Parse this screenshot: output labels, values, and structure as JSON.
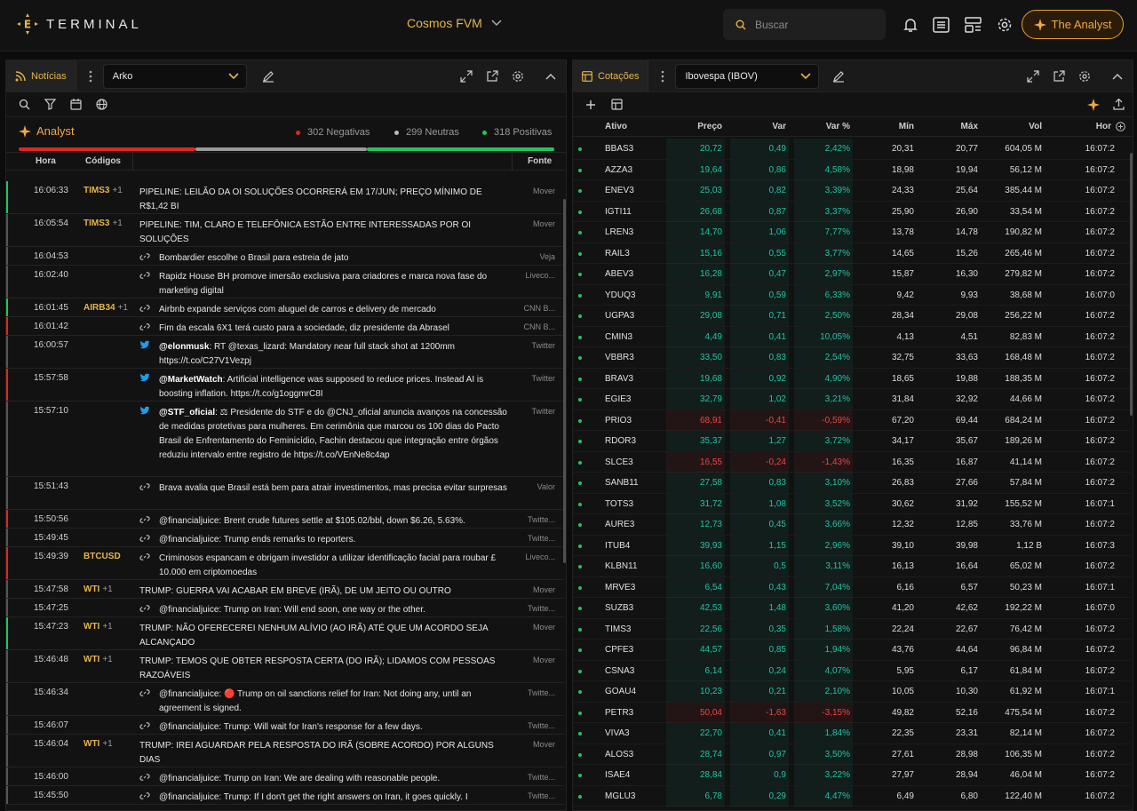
{
  "top": {
    "logo_text": "TERMINAL",
    "workspace": "Cosmos FVM",
    "search_placeholder": "Buscar",
    "analyst_btn": "The Analyst"
  },
  "news_panel": {
    "tab": "Notícias",
    "select": "Arko",
    "analyst": {
      "title": "Analyst",
      "negative": "302 Negativas",
      "neutral": "299 Neutras",
      "positive": "318 Positivas",
      "neg_frac": 0.33,
      "neu_frac": 0.32,
      "pos_frac": 0.35
    },
    "columns": {
      "hora": "Hora",
      "codigos": "Códigos",
      "fonte": "Fonte"
    },
    "rows": [
      {
        "time": "16:06:33",
        "code": "TIMS3",
        "extra": "+1",
        "link": false,
        "title": "PIPELINE: LEILÃO DA OI SOLUÇÕES OCORRERÁ EM 17/JUN; PREÇO MÍNIMO DE R$1,42 BI",
        "lines": 2,
        "src": "Mover",
        "bar": "#22c55e"
      },
      {
        "time": "16:05:54",
        "code": "TIMS3",
        "extra": "+1",
        "link": false,
        "title": "PIPELINE: TIM, CLARO E TELEFÔNICA ESTÃO ENTRE INTERESSADAS POR OI SOLUÇÕES",
        "lines": 2,
        "src": "Mover",
        "bar": "#555"
      },
      {
        "time": "16:04:53",
        "code": "",
        "extra": "",
        "link": "link",
        "title": "Bombardier escolhe o Brasil para estreia de jato",
        "lines": 1,
        "src": "Veja",
        "bar": "#555"
      },
      {
        "time": "16:02:40",
        "code": "",
        "extra": "",
        "link": "link",
        "title": "Rapidz House BH promove imersão exclusiva para criadores e marca nova fase do marketing digital",
        "lines": 2,
        "src": "Liveco...",
        "bar": "#555"
      },
      {
        "time": "16:01:45",
        "code": "AIRB34",
        "extra": "+1",
        "link": "link",
        "title": "Airbnb expande serviços com aluguel de carros e delivery de mercado",
        "lines": 1,
        "src": "CNN B...",
        "bar": "#22c55e"
      },
      {
        "time": "16:01:42",
        "code": "",
        "extra": "",
        "link": "link",
        "title": "Fim da escala 6X1 terá custo para a sociedade, diz presidente da Abrasel",
        "lines": 1,
        "src": "CNN B...",
        "bar": "#dc2626"
      },
      {
        "time": "16:00:57",
        "code": "",
        "extra": "",
        "link": "twitter",
        "handle": "@elonmusk",
        "title": ": RT @texas_lizard: Mandatory near full stack shot at 1200mm https://t.co/C27V1Vezpj",
        "lines": 2,
        "src": "Twitter",
        "bar": "#555"
      },
      {
        "time": "15:57:58",
        "code": "",
        "extra": "",
        "link": "twitter",
        "handle": "@MarketWatch",
        "title": ": Artificial intelligence was supposed to reduce prices. Instead AI is boosting inflation. https://t.co/g1oggmrC8I",
        "lines": 2,
        "src": "Twitter",
        "bar": "#dc2626"
      },
      {
        "time": "15:57:10",
        "code": "",
        "extra": "",
        "link": "twitter",
        "handle": "@STF_oficial",
        "title": ": ⚖ Presidente do STF e do @CNJ_oficial anuncia avanços na concessão de medidas protetivas para mulheres. Em cerimônia que marcou os 100 dias do Pacto Brasil de Enfrentamento do Feminicídio, Fachin destacou que integração entre órgãos reduziu intervalo entre registro de https://t.co/VEnNe8c4ap",
        "lines": 5,
        "src": "Twitter",
        "bar": "#555"
      },
      {
        "time": "15:51:43",
        "code": "",
        "extra": "",
        "link": "link",
        "title": "Brava avalia que Brasil está bem para atrair investimentos, mas precisa evitar surpresas",
        "lines": 2,
        "src": "Valor",
        "bar": "#555"
      },
      {
        "time": "15:50:56",
        "code": "",
        "extra": "",
        "link": "link",
        "title": "@financialjuice: Brent crude futures settle at $105.02/bbl, down $6.26, 5.63%.",
        "lines": 1,
        "src": "Twitte...",
        "bar": "#dc2626"
      },
      {
        "time": "15:49:45",
        "code": "",
        "extra": "",
        "link": "link",
        "title": "@financialjuice: Trump ends remarks to reporters.",
        "lines": 1,
        "src": "Twitte...",
        "bar": "#555"
      },
      {
        "time": "15:49:39",
        "code": "BTCUSD",
        "extra": "",
        "link": "link",
        "title": "Criminosos espancam e obrigam investidor a utilizar identificação facial para roubar £ 10.000 em criptomoedas",
        "lines": 2,
        "src": "Liveco...",
        "bar": "#dc2626"
      },
      {
        "time": "15:47:58",
        "code": "WTI",
        "extra": "+1",
        "link": false,
        "title": "TRUMP: GUERRA VAI ACABAR EM BREVE (IRÃ), DE UM JEITO OU OUTRO",
        "lines": 1,
        "src": "Mover",
        "bar": "#555"
      },
      {
        "time": "15:47:25",
        "code": "",
        "extra": "",
        "link": "link",
        "title": "@financialjuice: Trump on Iran: Will end soon, one way or the other.",
        "lines": 1,
        "src": "Twitte...",
        "bar": "#555"
      },
      {
        "time": "15:47:23",
        "code": "WTI",
        "extra": "+1",
        "link": false,
        "title": "TRUMP: NÃO OFERECEREI NENHUM ALÍVIO (AO IRÃ) ATÉ QUE UM ACORDO SEJA ALCANÇADO",
        "lines": 2,
        "src": "Mover",
        "bar": "#22c55e"
      },
      {
        "time": "15:46:48",
        "code": "WTI",
        "extra": "+1",
        "link": false,
        "title": "TRUMP: TEMOS QUE OBTER RESPOSTA CERTA (DO IRÃ); LIDAMOS COM PESSOAS RAZOÁVEIS",
        "lines": 2,
        "src": "Mover",
        "bar": "#555"
      },
      {
        "time": "15:46:34",
        "code": "",
        "extra": "",
        "link": "link",
        "title": "@financialjuice: 🔴 Trump on oil sanctions relief for Iran: Not doing any, until an agreement is signed.",
        "lines": 2,
        "src": "Twitte...",
        "bar": "#555"
      },
      {
        "time": "15:46:07",
        "code": "",
        "extra": "",
        "link": "link",
        "title": "@financialjuice: Trump: Will wait for Iran's response for a few days.",
        "lines": 1,
        "src": "Twitte...",
        "bar": "#555"
      },
      {
        "time": "15:46:04",
        "code": "WTI",
        "extra": "+1",
        "link": false,
        "title": "TRUMP: IREI AGUARDAR PELA RESPOSTA DO IRÃ (SOBRE ACORDO) POR ALGUNS DIAS",
        "lines": 2,
        "src": "Mover",
        "bar": "#555"
      },
      {
        "time": "15:46:00",
        "code": "",
        "extra": "",
        "link": "link",
        "title": "@financialjuice: Trump on Iran: We are dealing with reasonable people.",
        "lines": 1,
        "src": "Twitte...",
        "bar": "#555"
      },
      {
        "time": "15:45:50",
        "code": "",
        "extra": "",
        "link": "link",
        "title": "@financialjuice: Trump: If I don't get the right answers on Iran, it goes quickly. I",
        "lines": 1,
        "src": "Twitte...",
        "bar": "#555"
      }
    ]
  },
  "quote_panel": {
    "tab": "Cotações",
    "select": "Ibovespa (IBOV)",
    "columns": {
      "ativo": "Ativo",
      "preco": "Preço",
      "var": "Var",
      "varp": "Var %",
      "min": "Mín",
      "max": "Máx",
      "vol": "Vol",
      "hora": "Hor"
    },
    "colors": {
      "pos": "#22c3a6",
      "neg": "#ef4444"
    },
    "rows": [
      [
        "BBAS3",
        "20,72",
        "0,49",
        "2,42%",
        "20,31",
        "20,77",
        "604,05 M",
        "16:07:2",
        1
      ],
      [
        "AZZA3",
        "19,64",
        "0,86",
        "4,58%",
        "18,98",
        "19,94",
        "56,12 M",
        "16:07:2",
        1
      ],
      [
        "ENEV3",
        "25,03",
        "0,82",
        "3,39%",
        "24,33",
        "25,64",
        "385,44 M",
        "16:07:2",
        1
      ],
      [
        "IGTI11",
        "26,68",
        "0,87",
        "3,37%",
        "25,90",
        "26,90",
        "33,54 M",
        "16:07:2",
        1
      ],
      [
        "LREN3",
        "14,70",
        "1,06",
        "7,77%",
        "13,78",
        "14,78",
        "190,82 M",
        "16:07:2",
        1
      ],
      [
        "RAIL3",
        "15,16",
        "0,55",
        "3,77%",
        "14,65",
        "15,26",
        "265,46 M",
        "16:07:2",
        1
      ],
      [
        "ABEV3",
        "16,28",
        "0,47",
        "2,97%",
        "15,87",
        "16,30",
        "279,82 M",
        "16:07:2",
        1
      ],
      [
        "YDUQ3",
        "9,91",
        "0,59",
        "6,33%",
        "9,42",
        "9,93",
        "38,68 M",
        "16:07:0",
        1
      ],
      [
        "UGPA3",
        "29,08",
        "0,71",
        "2,50%",
        "28,34",
        "29,08",
        "256,22 M",
        "16:07:2",
        1
      ],
      [
        "CMIN3",
        "4,49",
        "0,41",
        "10,05%",
        "4,13",
        "4,51",
        "82,83 M",
        "16:07:2",
        1
      ],
      [
        "VBBR3",
        "33,50",
        "0,83",
        "2,54%",
        "32,75",
        "33,63",
        "168,48 M",
        "16:07:2",
        1
      ],
      [
        "BRAV3",
        "19,68",
        "0,92",
        "4,90%",
        "18,65",
        "19,88",
        "188,35 M",
        "16:07:2",
        1
      ],
      [
        "EGIE3",
        "32,79",
        "1,02",
        "3,21%",
        "31,84",
        "32,92",
        "44,66 M",
        "16:07:2",
        1
      ],
      [
        "PRIO3",
        "68,91",
        "-0,41",
        "-0,59%",
        "67,20",
        "69,44",
        "684,24 M",
        "16:07:2",
        0
      ],
      [
        "RDOR3",
        "35,37",
        "1,27",
        "3,72%",
        "34,17",
        "35,67",
        "189,26 M",
        "16:07:2",
        1
      ],
      [
        "SLCE3",
        "16,55",
        "-0,24",
        "-1,43%",
        "16,35",
        "16,87",
        "41,14 M",
        "16:07:2",
        0
      ],
      [
        "SANB11",
        "27,58",
        "0,83",
        "3,10%",
        "26,83",
        "27,66",
        "57,84 M",
        "16:07:2",
        1
      ],
      [
        "TOTS3",
        "31,72",
        "1,08",
        "3,52%",
        "30,62",
        "31,92",
        "155,52 M",
        "16:07:1",
        1
      ],
      [
        "AURE3",
        "12,73",
        "0,45",
        "3,66%",
        "12,32",
        "12,85",
        "33,76 M",
        "16:07:2",
        1
      ],
      [
        "ITUB4",
        "39,93",
        "1,15",
        "2,96%",
        "39,10",
        "39,98",
        "1,12 B",
        "16:07:3",
        1
      ],
      [
        "KLBN11",
        "16,60",
        "0,5",
        "3,11%",
        "16,13",
        "16,64",
        "65,02 M",
        "16:07:2",
        1
      ],
      [
        "MRVE3",
        "6,54",
        "0,43",
        "7,04%",
        "6,16",
        "6,57",
        "50,23 M",
        "16:07:1",
        1
      ],
      [
        "SUZB3",
        "42,53",
        "1,48",
        "3,60%",
        "41,20",
        "42,62",
        "192,22 M",
        "16:07:0",
        1
      ],
      [
        "TIMS3",
        "22,56",
        "0,35",
        "1,58%",
        "22,24",
        "22,67",
        "76,42 M",
        "16:07:2",
        1
      ],
      [
        "CPFE3",
        "44,57",
        "0,85",
        "1,94%",
        "43,76",
        "44,64",
        "96,84 M",
        "16:07:2",
        1
      ],
      [
        "CSNA3",
        "6,14",
        "0,24",
        "4,07%",
        "5,95",
        "6,17",
        "61,84 M",
        "16:07:2",
        1
      ],
      [
        "GOAU4",
        "10,23",
        "0,21",
        "2,10%",
        "10,05",
        "10,30",
        "61,92 M",
        "16:07:1",
        1
      ],
      [
        "PETR3",
        "50,04",
        "-1,63",
        "-3,15%",
        "49,82",
        "52,16",
        "475,54 M",
        "16:07:2",
        0
      ],
      [
        "VIVA3",
        "22,70",
        "0,41",
        "1,84%",
        "22,35",
        "23,31",
        "82,14 M",
        "16:07:2",
        1
      ],
      [
        "ALOS3",
        "28,74",
        "0,97",
        "3,50%",
        "27,61",
        "28,98",
        "106,35 M",
        "16:07:2",
        1
      ],
      [
        "ISAE4",
        "28,84",
        "0,9",
        "3,22%",
        "27,97",
        "28,94",
        "46,04 M",
        "16:07:2",
        1
      ],
      [
        "MGLU3",
        "6,78",
        "0,29",
        "4,47%",
        "6,49",
        "6,80",
        "122,40 M",
        "16:07:2",
        1
      ]
    ]
  }
}
